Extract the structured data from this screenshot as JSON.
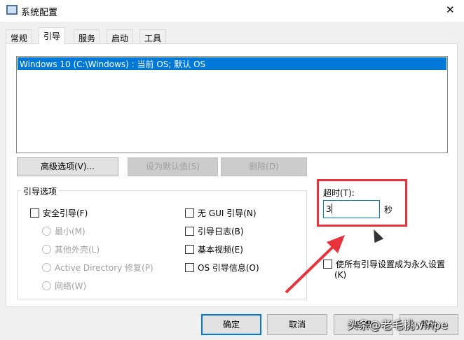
{
  "window": {
    "title": "系统配置",
    "close": "✕"
  },
  "tabs": [
    "常规",
    "引导",
    "服务",
    "启动",
    "工具"
  ],
  "boot_list": [
    "Windows 10 (C:\\Windows) : 当前 OS; 默认 OS"
  ],
  "buttons": {
    "advanced": "高级选项(V)...",
    "set_default": "设为默认值(S)",
    "delete": "删除(D)"
  },
  "boot_options": {
    "title": "引导选项",
    "safe_boot": "安全引导(F)",
    "minimal": "最小(M)",
    "alternate_shell": "其他外壳(L)",
    "ad_repair": "Active Directory 修复(P)",
    "network": "网络(W)",
    "no_gui": "无 GUI 引导(N)",
    "boot_log": "引导日志(B)",
    "base_video": "基本视频(E)",
    "os_info": "OS 引导信息(O)"
  },
  "timeout": {
    "label": "超时(T):",
    "value": "3",
    "unit": "秒"
  },
  "permanent": {
    "label": "使所有引导设置成为永久设置",
    "key": "(K)"
  },
  "footer": {
    "ok": "确定",
    "cancel": "取消",
    "apply": "应用",
    "help": "帮助"
  },
  "watermark": "头条@老毛桃winpe",
  "colors": {
    "selection": "#0078d7",
    "annotation": "#e8323c"
  }
}
